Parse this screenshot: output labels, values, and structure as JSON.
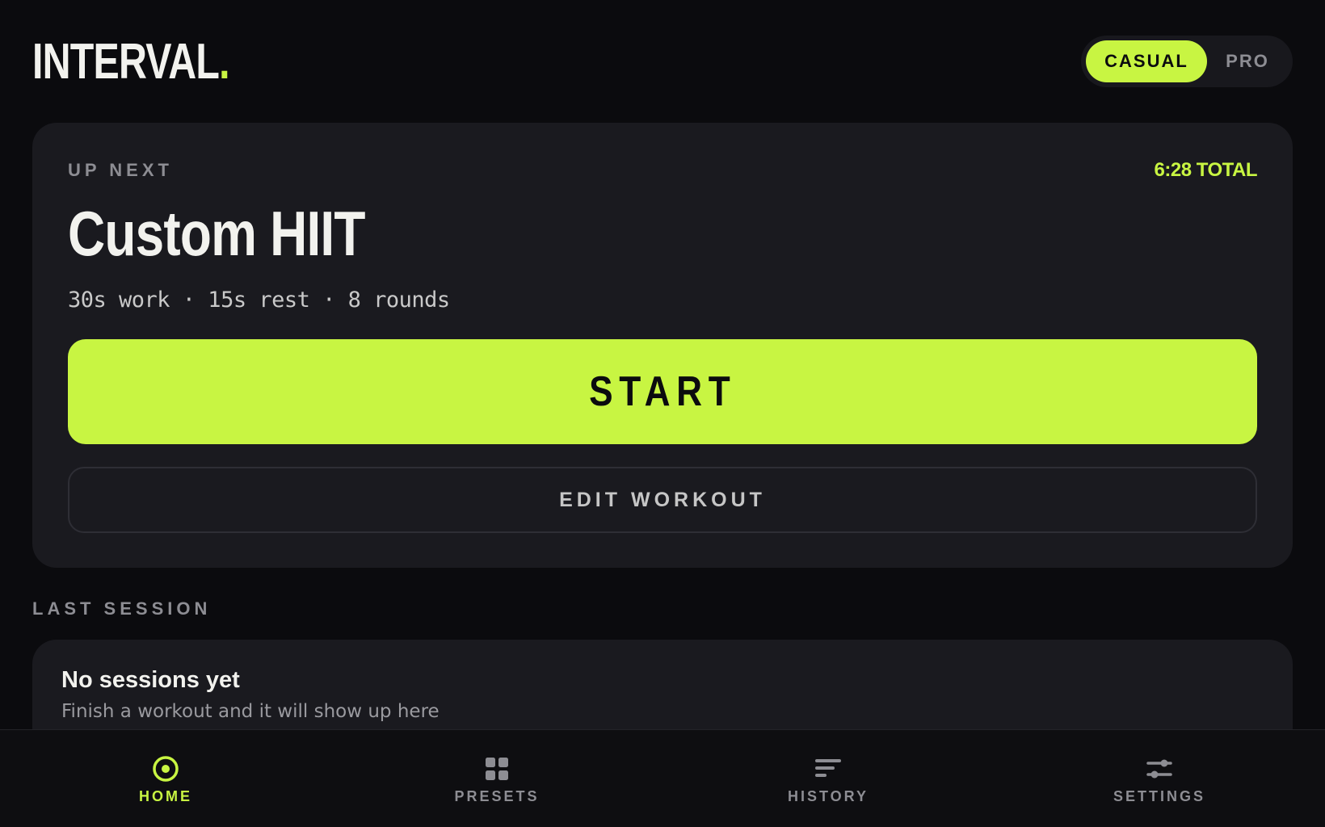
{
  "brand": {
    "name": "INTERVAL",
    "dot": ".",
    "accent_color": "#c8f542"
  },
  "mode": {
    "options": [
      "CASUAL",
      "PRO"
    ],
    "selected": "CASUAL"
  },
  "up_next": {
    "eyebrow": "UP NEXT",
    "total": "6:28 TOTAL",
    "title": "Custom HIIT",
    "meta": "30s work · 15s rest · 8 rounds",
    "start_label": "START",
    "edit_label": "EDIT WORKOUT"
  },
  "last_session": {
    "label": "LAST SESSION",
    "empty_title": "No sessions yet",
    "empty_subtitle": "Finish a workout and it will show up here"
  },
  "nav": {
    "items": [
      {
        "label": "HOME",
        "icon": "target-icon",
        "active": true
      },
      {
        "label": "PRESETS",
        "icon": "grid-icon",
        "active": false
      },
      {
        "label": "HISTORY",
        "icon": "list-bars-icon",
        "active": false
      },
      {
        "label": "SETTINGS",
        "icon": "sliders-icon",
        "active": false
      }
    ]
  }
}
